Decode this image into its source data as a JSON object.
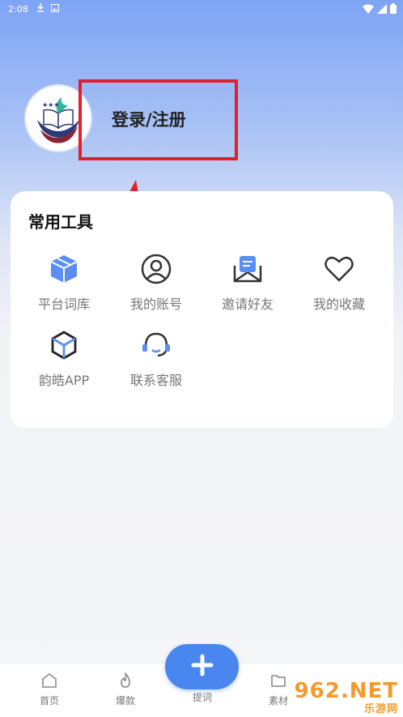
{
  "status_bar": {
    "time": "2:08"
  },
  "profile": {
    "login_label": "登录/注册"
  },
  "tools": {
    "title": "常用工具",
    "items": [
      {
        "label": "平台词库",
        "icon": "cube-icon"
      },
      {
        "label": "我的账号",
        "icon": "user-icon"
      },
      {
        "label": "邀请好友",
        "icon": "mail-icon"
      },
      {
        "label": "我的收藏",
        "icon": "heart-icon"
      },
      {
        "label": "韵皓APP",
        "icon": "box-icon"
      },
      {
        "label": "联系客服",
        "icon": "headset-icon"
      }
    ]
  },
  "tabbar": {
    "tabs": [
      {
        "label": "首页",
        "icon": "home-icon"
      },
      {
        "label": "爆款",
        "icon": "fire-icon"
      },
      {
        "label": "提词",
        "icon": "plus-icon"
      },
      {
        "label": "素材",
        "icon": "folder-icon"
      }
    ]
  },
  "watermark": {
    "brand": "962.NET",
    "sub": "乐游网"
  },
  "colors": {
    "accent": "#4a86f0",
    "annotation_red": "#e0202a",
    "watermark": "#f39a2a"
  }
}
